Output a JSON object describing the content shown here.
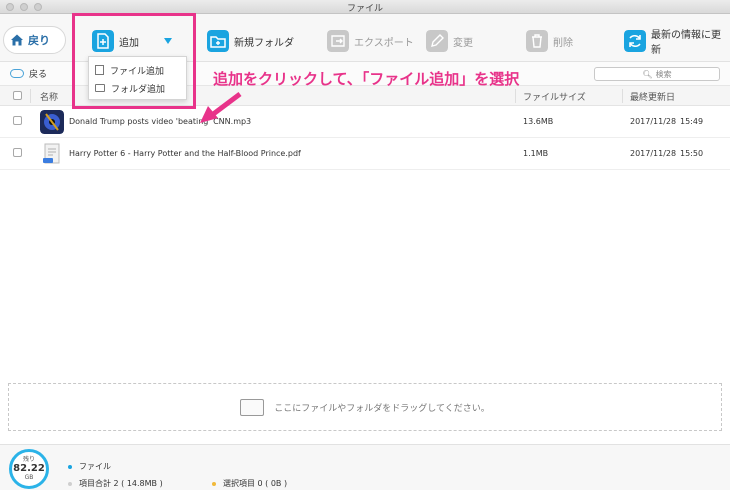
{
  "window": {
    "title": "ファイル"
  },
  "toolbar": {
    "back_label": "戻り",
    "add_label": "追加",
    "new_folder_label": "新規フォルダ",
    "export_label": "エクスポート",
    "edit_label": "変更",
    "delete_label": "削除",
    "refresh_label": "最新の情報に更新"
  },
  "dropdown": {
    "items": [
      {
        "label": "ファイル追加"
      },
      {
        "label": "フォルダ追加"
      }
    ]
  },
  "annotation": {
    "text": "追加をクリックして、「ファイル追加」を選択",
    "color": "#e8338a"
  },
  "subbar": {
    "back_label": "戻る",
    "search_placeholder": "検索"
  },
  "table": {
    "columns": {
      "name": "名称",
      "size": "ファイルサイズ",
      "modified": "最終更新日"
    },
    "rows": [
      {
        "name": "Donald Trump posts video 'beating' CNN.mp3",
        "size": "13.6MB",
        "date": "2017/11/28",
        "time": "15:49",
        "icon": "music-thumb-icon"
      },
      {
        "name": "Harry Potter 6 - Harry Potter and the Half-Blood Prince.pdf",
        "size": "1.1MB",
        "date": "2017/11/28",
        "time": "15:50",
        "icon": "pdf-thumb-icon"
      }
    ]
  },
  "dropzone": {
    "text": "ここにファイルやフォルダをドラッグしてください。"
  },
  "footer": {
    "storage_label": "残り",
    "storage_value": "82.22",
    "storage_unit": "GB",
    "legend_files": "ファイル",
    "total_items": "項目合計 2 ( 14.8MB )",
    "selected_items": "選択項目 0 ( 0B )"
  },
  "colors": {
    "accent": "#1aa4e0",
    "highlight": "#e8338a",
    "selected_dot": "#f1b93a"
  }
}
